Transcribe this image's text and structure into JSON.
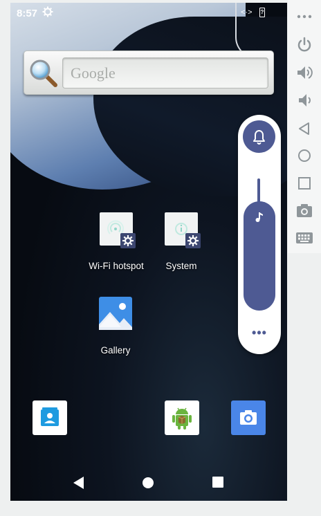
{
  "status_bar": {
    "time": "8:57",
    "data_indicator": "<·>",
    "battery_label": "?"
  },
  "search_widget": {
    "placeholder": "Google"
  },
  "desktop_apps": [
    {
      "label": "Wi-Fi hotspot",
      "icon": "wifi-hotspot-settings-icon"
    },
    {
      "label": "System",
      "icon": "system-settings-icon"
    },
    {
      "label": "Gallery",
      "icon": "gallery-icon"
    }
  ],
  "dock": [
    {
      "icon": "contacts-icon"
    },
    {
      "icon": "android-package-icon"
    },
    {
      "icon": "camera-icon"
    }
  ],
  "volume_panel": {
    "stream": "music",
    "level": 0.85,
    "more_label": "•••"
  },
  "nav_bar": [
    "back-icon",
    "home-icon",
    "recents-icon"
  ],
  "side_toolbar": [
    "more-options-icon",
    "power-icon",
    "volume-up-icon",
    "volume-down-icon",
    "back-icon",
    "home-icon",
    "overview-icon",
    "screenshot-camera-icon",
    "keyboard-icon"
  ],
  "colors": {
    "accent": "#4e5a93",
    "badge": "#3c4670",
    "screen_bg": "#070b12"
  }
}
